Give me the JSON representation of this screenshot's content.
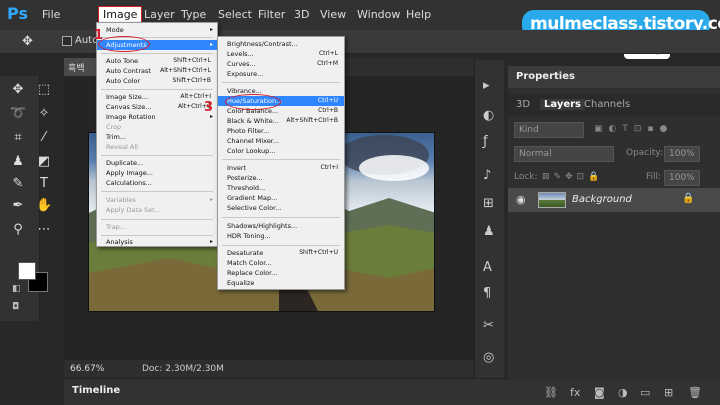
{
  "app": {
    "logo": "Ps"
  },
  "menubar": {
    "items": [
      "File",
      "Image",
      "Layer",
      "Type",
      "Select",
      "Filter",
      "3D",
      "View",
      "Window",
      "Help"
    ],
    "open": "Image"
  },
  "options_bar": {
    "auto_select": "Auto-Se"
  },
  "document": {
    "tab_label": "흑백",
    "zoom": "66.67%",
    "doc_size": "Doc: 2.30M/2.30M"
  },
  "image_menu": {
    "items": [
      {
        "label": "Mode",
        "shortcut": "",
        "arrow": "▸",
        "disabled": false
      },
      {
        "label": "Adjustments",
        "shortcut": "",
        "arrow": "▸",
        "disabled": false,
        "highlight": true
      },
      {
        "label": "Auto Tone",
        "shortcut": "Shift+Ctrl+L",
        "disabled": false
      },
      {
        "label": "Auto Contrast",
        "shortcut": "Alt+Shift+Ctrl+L",
        "disabled": false
      },
      {
        "label": "Auto Color",
        "shortcut": "Shift+Ctrl+B",
        "disabled": false
      },
      {
        "label": "Image Size...",
        "shortcut": "Alt+Ctrl+I",
        "disabled": false
      },
      {
        "label": "Canvas Size...",
        "shortcut": "Alt+Ctrl+C",
        "disabled": false
      },
      {
        "label": "Image Rotation",
        "shortcut": "",
        "arrow": "▸",
        "disabled": false
      },
      {
        "label": "Crop",
        "shortcut": "",
        "disabled": true
      },
      {
        "label": "Trim...",
        "shortcut": "",
        "disabled": false
      },
      {
        "label": "Reveal All",
        "shortcut": "",
        "disabled": true
      },
      {
        "label": "Duplicate...",
        "shortcut": "",
        "disabled": false
      },
      {
        "label": "Apply Image...",
        "shortcut": "",
        "disabled": false
      },
      {
        "label": "Calculations...",
        "shortcut": "",
        "disabled": false
      },
      {
        "label": "Variables",
        "shortcut": "",
        "arrow": "▸",
        "disabled": true
      },
      {
        "label": "Apply Data Set...",
        "shortcut": "",
        "disabled": true
      },
      {
        "label": "Trap...",
        "shortcut": "",
        "disabled": true
      },
      {
        "label": "Analysis",
        "shortcut": "",
        "arrow": "▸",
        "disabled": false
      }
    ]
  },
  "adjustments_menu": {
    "items": [
      {
        "label": "Brightness/Contrast...",
        "shortcut": ""
      },
      {
        "label": "Levels...",
        "shortcut": "Ctrl+L"
      },
      {
        "label": "Curves...",
        "shortcut": "Ctrl+M"
      },
      {
        "label": "Exposure...",
        "shortcut": ""
      },
      {
        "label": "Vibrance...",
        "shortcut": ""
      },
      {
        "label": "Hue/Saturation...",
        "shortcut": "Ctrl+U",
        "highlight": true
      },
      {
        "label": "Color Balance...",
        "shortcut": "Ctrl+B"
      },
      {
        "label": "Black & White...",
        "shortcut": "Alt+Shift+Ctrl+B"
      },
      {
        "label": "Photo Filter...",
        "shortcut": ""
      },
      {
        "label": "Channel Mixer...",
        "shortcut": ""
      },
      {
        "label": "Color Lookup...",
        "shortcut": ""
      },
      {
        "label": "Invert",
        "shortcut": "Ctrl+I"
      },
      {
        "label": "Posterize...",
        "shortcut": ""
      },
      {
        "label": "Threshold...",
        "shortcut": ""
      },
      {
        "label": "Gradient Map...",
        "shortcut": ""
      },
      {
        "label": "Selective Color...",
        "shortcut": ""
      },
      {
        "label": "Shadows/Highlights...",
        "shortcut": ""
      },
      {
        "label": "HDR Toning...",
        "shortcut": ""
      },
      {
        "label": "Desaturate",
        "shortcut": "Shift+Ctrl+U"
      },
      {
        "label": "Match Color...",
        "shortcut": ""
      },
      {
        "label": "Replace Color...",
        "shortcut": ""
      },
      {
        "label": "Equalize",
        "shortcut": ""
      }
    ]
  },
  "annotations": {
    "step1": "1",
    "step3": "3"
  },
  "panel": {
    "header": "Properties",
    "tabs": [
      "3D",
      "Layers",
      "Channels"
    ],
    "active_tab": "Layers",
    "kind_filter": "Kind",
    "blend_mode": "Normal",
    "opacity_label": "Opacity:",
    "opacity_value": "100%",
    "lock_label": "Lock:",
    "fill_label": "Fill:",
    "fill_value": "100%",
    "layers": [
      {
        "name": "Background",
        "visible": true,
        "locked": true
      }
    ]
  },
  "timeline": {
    "label": "Timeline"
  },
  "watermark": {
    "site": "mulmeclass.tistory.com",
    "logo": "Mc"
  },
  "colors": {
    "accent": "#2f86ff",
    "annotation": "#d2202a",
    "brand": "#2aa9ea"
  }
}
